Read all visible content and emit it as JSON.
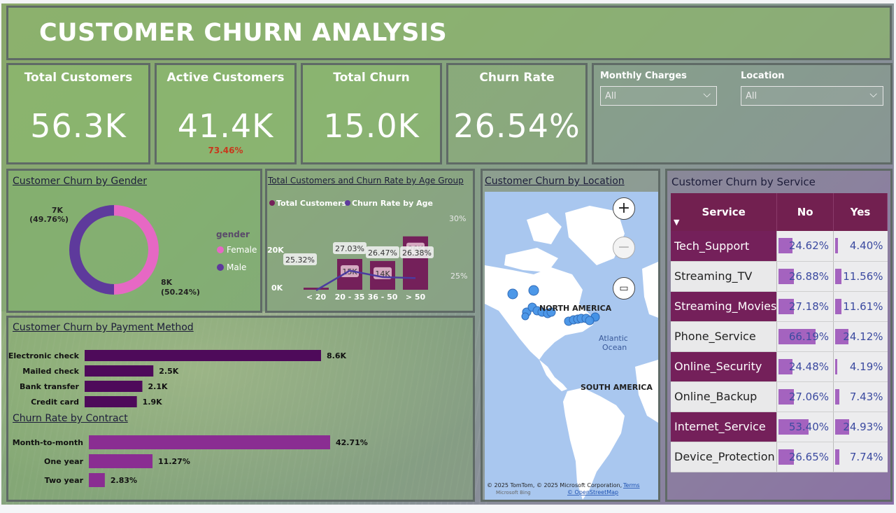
{
  "title": "CUSTOMER CHURN ANALYSIS",
  "kpis": [
    {
      "label": "Total Customers",
      "value": "56.3K"
    },
    {
      "label": "Active Customers",
      "value": "41.4K",
      "sub": "73.46%"
    },
    {
      "label": "Total Churn",
      "value": "15.0K"
    },
    {
      "label": "Churn Rate",
      "value": "26.54%"
    }
  ],
  "filters": {
    "monthly_charges": {
      "label": "Monthly Charges",
      "value": "All"
    },
    "location": {
      "label": "Location",
      "value": "All"
    }
  },
  "gender_chart": {
    "title": "Customer Churn by Gender",
    "legend_title": "gender",
    "female_label": "Female",
    "male_label": "Male",
    "male_value": "7K",
    "male_pct": "(49.76%)",
    "female_value": "8K",
    "female_pct": "(50.24%)",
    "colors": {
      "female": "#e668c4",
      "male": "#5e3a9c"
    }
  },
  "chart_data": [
    {
      "type": "bar",
      "title": "Total Customers and Churn Rate by Age Group",
      "categories": [
        "< 20",
        "20 - 35",
        "36 - 50",
        "> 50"
      ],
      "series": [
        {
          "name": "Total Customers",
          "type": "bar",
          "values": [
            1,
            15,
            14,
            26
          ],
          "labels": [
            "",
            "15K",
            "14K",
            "26K"
          ]
        },
        {
          "name": "Churn Rate by Age",
          "type": "line",
          "values": [
            25.32,
            27.03,
            26.47,
            26.38
          ],
          "labels": [
            "25.32%",
            "27.03%",
            "26.47%",
            "26.38%"
          ]
        }
      ],
      "y_left_ticks": [
        "0K",
        "20K"
      ],
      "y_right_ticks": [
        "25%",
        "30%"
      ]
    },
    {
      "type": "bar",
      "title": "Customer Churn by Payment Method",
      "categories": [
        "Electronic check",
        "Mailed check",
        "Bank transfer",
        "Credit card"
      ],
      "values": [
        8.6,
        2.5,
        2.1,
        1.9
      ],
      "labels": [
        "8.6K",
        "2.5K",
        "2.1K",
        "1.9K"
      ]
    },
    {
      "type": "bar",
      "title": "Churn Rate by Contract",
      "categories": [
        "Month-to-month",
        "One year",
        "Two year"
      ],
      "values": [
        42.71,
        11.27,
        2.83
      ],
      "labels": [
        "42.71%",
        "11.27%",
        "2.83%"
      ]
    }
  ],
  "location": {
    "title": "Customer Churn by Location",
    "north_america": "NORTH AMERICA",
    "south_america": "SOUTH AMERICA",
    "atlantic_line1": "Atlantic",
    "atlantic_line2": "Ocean",
    "attribution": "© 2025 TomTom, © 2025 Microsoft Corporation,",
    "terms": "Terms",
    "osm": "© OpenStreetMap",
    "bing": "Microsoft Bing"
  },
  "service": {
    "title": "Customer Churn by Service",
    "headers": {
      "service": "Service",
      "no": "No",
      "yes": "Yes"
    },
    "rows": [
      {
        "name": "Tech_Support",
        "no": "24.62%",
        "yes": "4.40%",
        "no_v": 24.62,
        "yes_v": 4.4,
        "hl": true
      },
      {
        "name": "Streaming_TV",
        "no": "26.88%",
        "yes": "11.56%",
        "no_v": 26.88,
        "yes_v": 11.56,
        "hl": false
      },
      {
        "name": "Streaming_Movies",
        "no": "27.18%",
        "yes": "11.61%",
        "no_v": 27.18,
        "yes_v": 11.61,
        "hl": true
      },
      {
        "name": "Phone_Service",
        "no": "66.19%",
        "yes": "24.12%",
        "no_v": 66.19,
        "yes_v": 24.12,
        "hl": false
      },
      {
        "name": "Online_Security",
        "no": "24.48%",
        "yes": "4.19%",
        "no_v": 24.48,
        "yes_v": 4.19,
        "hl": true
      },
      {
        "name": "Online_Backup",
        "no": "27.06%",
        "yes": "7.43%",
        "no_v": 27.06,
        "yes_v": 7.43,
        "hl": false
      },
      {
        "name": "Internet_Service",
        "no": "53.40%",
        "yes": "24.93%",
        "no_v": 53.4,
        "yes_v": 24.93,
        "hl": true
      },
      {
        "name": "Device_Protection",
        "no": "26.65%",
        "yes": "7.74%",
        "no_v": 26.65,
        "yes_v": 7.74,
        "hl": false
      }
    ]
  }
}
